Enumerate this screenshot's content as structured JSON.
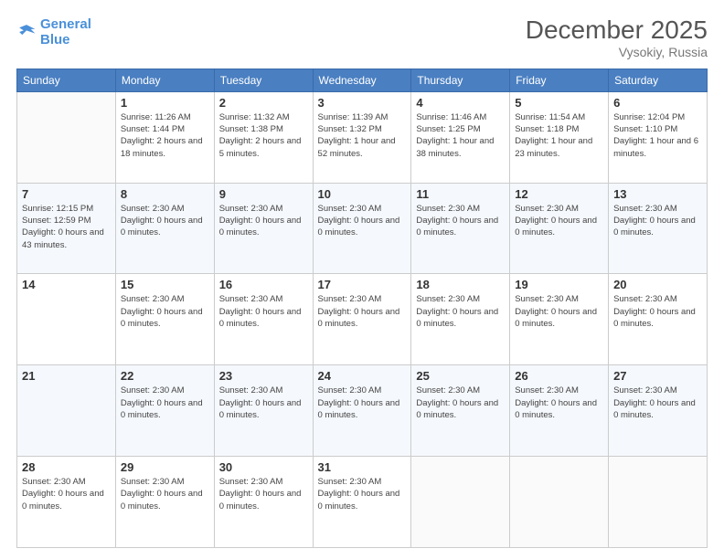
{
  "header": {
    "logo_line1": "General",
    "logo_line2": "Blue",
    "month_year": "December 2025",
    "location": "Vysokiy, Russia"
  },
  "weekdays": [
    "Sunday",
    "Monday",
    "Tuesday",
    "Wednesday",
    "Thursday",
    "Friday",
    "Saturday"
  ],
  "weeks": [
    [
      {
        "num": "",
        "info": ""
      },
      {
        "num": "1",
        "info": "Sunrise: 11:26 AM\nSunset: 1:44 PM\nDaylight: 2 hours and 18 minutes."
      },
      {
        "num": "2",
        "info": "Sunrise: 11:32 AM\nSunset: 1:38 PM\nDaylight: 2 hours and 5 minutes."
      },
      {
        "num": "3",
        "info": "Sunrise: 11:39 AM\nSunset: 1:32 PM\nDaylight: 1 hour and 52 minutes."
      },
      {
        "num": "4",
        "info": "Sunrise: 11:46 AM\nSunset: 1:25 PM\nDaylight: 1 hour and 38 minutes."
      },
      {
        "num": "5",
        "info": "Sunrise: 11:54 AM\nSunset: 1:18 PM\nDaylight: 1 hour and 23 minutes."
      },
      {
        "num": "6",
        "info": "Sunrise: 12:04 PM\nSunset: 1:10 PM\nDaylight: 1 hour and 6 minutes."
      }
    ],
    [
      {
        "num": "7",
        "info": "Sunrise: 12:15 PM\nSunset: 12:59 PM\nDaylight: 0 hours and 43 minutes."
      },
      {
        "num": "8",
        "info": "Sunset: 2:30 AM\nDaylight: 0 hours and 0 minutes."
      },
      {
        "num": "9",
        "info": "Sunset: 2:30 AM\nDaylight: 0 hours and 0 minutes."
      },
      {
        "num": "10",
        "info": "Sunset: 2:30 AM\nDaylight: 0 hours and 0 minutes."
      },
      {
        "num": "11",
        "info": "Sunset: 2:30 AM\nDaylight: 0 hours and 0 minutes."
      },
      {
        "num": "12",
        "info": "Sunset: 2:30 AM\nDaylight: 0 hours and 0 minutes."
      },
      {
        "num": "13",
        "info": "Sunset: 2:30 AM\nDaylight: 0 hours and 0 minutes."
      }
    ],
    [
      {
        "num": "14",
        "info": ""
      },
      {
        "num": "15",
        "info": "Sunset: 2:30 AM\nDaylight: 0 hours and 0 minutes."
      },
      {
        "num": "16",
        "info": "Sunset: 2:30 AM\nDaylight: 0 hours and 0 minutes."
      },
      {
        "num": "17",
        "info": "Sunset: 2:30 AM\nDaylight: 0 hours and 0 minutes."
      },
      {
        "num": "18",
        "info": "Sunset: 2:30 AM\nDaylight: 0 hours and 0 minutes."
      },
      {
        "num": "19",
        "info": "Sunset: 2:30 AM\nDaylight: 0 hours and 0 minutes."
      },
      {
        "num": "20",
        "info": "Sunset: 2:30 AM\nDaylight: 0 hours and 0 minutes."
      }
    ],
    [
      {
        "num": "21",
        "info": ""
      },
      {
        "num": "22",
        "info": "Sunset: 2:30 AM\nDaylight: 0 hours and 0 minutes."
      },
      {
        "num": "23",
        "info": "Sunset: 2:30 AM\nDaylight: 0 hours and 0 minutes."
      },
      {
        "num": "24",
        "info": "Sunset: 2:30 AM\nDaylight: 0 hours and 0 minutes."
      },
      {
        "num": "25",
        "info": "Sunset: 2:30 AM\nDaylight: 0 hours and 0 minutes."
      },
      {
        "num": "26",
        "info": "Sunset: 2:30 AM\nDaylight: 0 hours and 0 minutes."
      },
      {
        "num": "27",
        "info": "Sunset: 2:30 AM\nDaylight: 0 hours and 0 minutes."
      }
    ],
    [
      {
        "num": "28",
        "info": "Sunset: 2:30 AM\nDaylight: 0 hours and 0 minutes."
      },
      {
        "num": "29",
        "info": "Sunset: 2:30 AM\nDaylight: 0 hours and 0 minutes."
      },
      {
        "num": "30",
        "info": "Sunset: 2:30 AM\nDaylight: 0 hours and 0 minutes."
      },
      {
        "num": "31",
        "info": "Sunset: 2:30 AM\nDaylight: 0 hours and 0 minutes."
      },
      {
        "num": "",
        "info": ""
      },
      {
        "num": "",
        "info": ""
      },
      {
        "num": "",
        "info": ""
      }
    ]
  ]
}
